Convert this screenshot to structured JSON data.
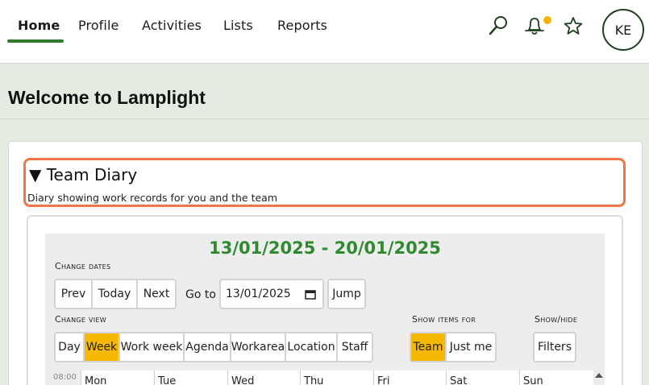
{
  "nav": {
    "items": [
      {
        "label": "Home",
        "active": true
      },
      {
        "label": "Profile"
      },
      {
        "label": "Activities"
      },
      {
        "label": "Lists"
      },
      {
        "label": "Reports"
      }
    ],
    "icons": [
      "search-icon",
      "bell-icon",
      "star-icon"
    ],
    "avatar": "KE",
    "accent": "#2e7a2e",
    "notification_color": "#f4b400"
  },
  "page": {
    "title": "Welcome to Lamplight"
  },
  "diary": {
    "title": "▼ Team Diary",
    "description": "Diary showing work records for you and the team",
    "highlight_color": "#f07644"
  },
  "calendar": {
    "date_range": "13/01/2025 - 20/01/2025",
    "change_dates_label": "Change dates",
    "prev": "Prev",
    "today": "Today",
    "next": "Next",
    "goto_label": "Go to",
    "goto_value": "13/01/2025",
    "jump": "Jump",
    "change_view_label": "Change view",
    "views": [
      "Day",
      "Week",
      "Work week",
      "Agenda",
      "Workarea",
      "Location",
      "Staff"
    ],
    "active_view": "Week",
    "show_items_label": "Show items for",
    "show_items": [
      "Team",
      "Just me"
    ],
    "active_show": "Team",
    "show_hide_label": "Show/hide",
    "filters": "Filters",
    "time": "08:00",
    "days": [
      "Mon",
      "Tue",
      "Wed",
      "Thu",
      "Fri",
      "Sat",
      "Sun"
    ],
    "active_color": "#f6b800"
  }
}
